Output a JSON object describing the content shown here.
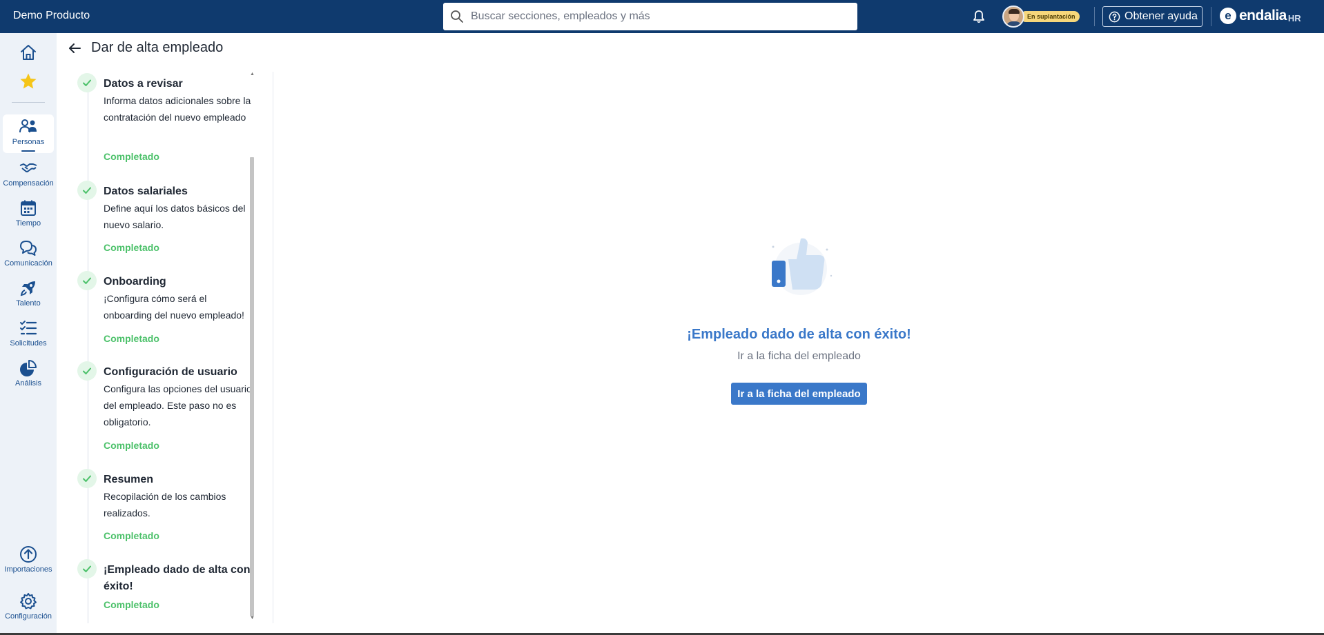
{
  "topbar": {
    "app_name": "Demo Producto",
    "search_placeholder": "Buscar secciones, empleados y más",
    "impersonation_badge": "En suplantación",
    "help_label": "Obtener ayuda",
    "brand_name": "endalia",
    "brand_suffix": "HR",
    "brand_logo_letter": "e",
    "colors": {
      "bar": "#0f3a6e",
      "badge": "#f6d77b"
    }
  },
  "leftnav": {
    "items": [
      {
        "label": "",
        "icon": "home-icon"
      },
      {
        "label": "",
        "icon": "star-icon"
      },
      {
        "label": "Personas",
        "icon": "people-icon",
        "active": true
      },
      {
        "label": "Compensación",
        "icon": "handshake-icon"
      },
      {
        "label": "Tiempo",
        "icon": "calendar-icon"
      },
      {
        "label": "Comunicación",
        "icon": "chat-icon"
      },
      {
        "label": "Talento",
        "icon": "rocket-icon"
      },
      {
        "label": "Solicitudes",
        "icon": "checklist-icon"
      },
      {
        "label": "Análisis",
        "icon": "pie-chart-icon"
      },
      {
        "label": "Importaciones",
        "icon": "upload-circle-icon"
      },
      {
        "label": "Configuración",
        "icon": "gear-icon"
      }
    ]
  },
  "page": {
    "title": "Dar de alta empleado",
    "back_icon": "arrow-left-icon"
  },
  "steps": [
    {
      "title": "Datos a revisar",
      "desc": "Informa datos adicionales sobre la contratación del nuevo empleado",
      "status": "Completado"
    },
    {
      "title": "Datos salariales",
      "desc": "Define aquí los datos básicos del nuevo salario.",
      "status": "Completado"
    },
    {
      "title": "Onboarding",
      "desc": "¡Configura cómo será el onboarding del nuevo empleado!",
      "status": "Completado"
    },
    {
      "title": "Configuración de usuario",
      "desc": "Configura las opciones del usuario del empleado. Este paso no es obligatorio.",
      "status": "Completado"
    },
    {
      "title": "Resumen",
      "desc": "Recopilación de los cambios realizados.",
      "status": "Completado"
    },
    {
      "title": "¡Empleado dado de alta con éxito!",
      "desc": "",
      "status": "Completado"
    }
  ],
  "success": {
    "illustration_icon": "thumbs-up-icon",
    "title": "¡Empleado dado de alta con éxito!",
    "subtitle": "Ir a la ficha del empleado",
    "button_label": "Ir a la ficha del empleado",
    "accent_color": "#3a78c9",
    "status_color": "#4cc16a"
  }
}
